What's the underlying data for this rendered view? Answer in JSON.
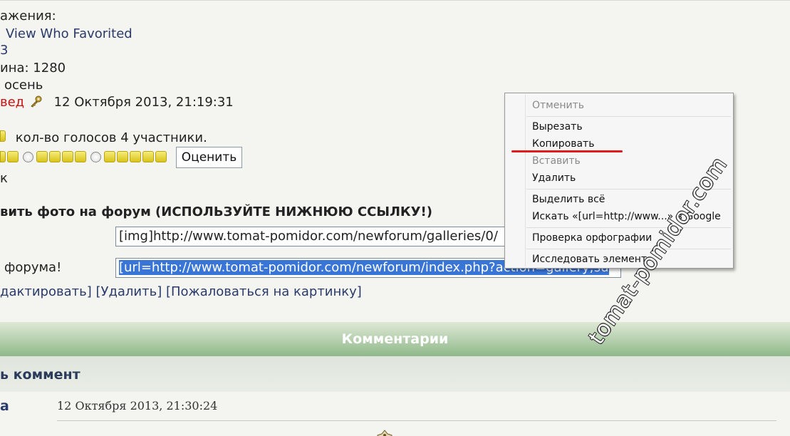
{
  "info": {
    "views_label": "ажения:",
    "who_favorited_link": "View Who Favorited",
    "fragment_b": "3",
    "width_label": "ина: 1280",
    "autumn_label": "осень",
    "author_fragment": "вед",
    "date": "12 Октября 2013, 21:19:31",
    "votes_text": "кол-во голосов 4 участники.",
    "fragment_k": "к"
  },
  "rating": {
    "button_label": "Оценить",
    "star_groups": [
      2,
      4,
      5
    ]
  },
  "embed": {
    "heading": "вить фото на форум (ИСПОЛЬЗУЙТЕ НИЖНЮЮ ССЫЛКУ!)",
    "img_code": "[img]http://www.tomat-pomidor.com/newforum/galleries/0/",
    "forum_label": "форума!",
    "url_code": "[url=http://www.tomat-pomidor.com/newforum/index.php?action=gallery;su"
  },
  "actions": {
    "text": "дактировать] [Удалить] [Пожаловаться на картинку]"
  },
  "comments": {
    "title": "Комментарии",
    "add_label": "ь коммент",
    "author": "а",
    "date": "12 Октября 2013, 21:30:24"
  },
  "context_menu": {
    "undo": "Отменить",
    "cut": "Вырезать",
    "copy": "Копировать",
    "paste": "Вставить",
    "delete": "Удалить",
    "select_all": "Выделить всё",
    "search": "Искать «[url=http://www...» в Google",
    "spellcheck": "Проверка орфографии",
    "inspect": "Исследовать элемент"
  },
  "watermark": "tomat-pomidor.com",
  "colors": {
    "link": "#2a3b6b",
    "highlight": "#e01b1b",
    "selection": "#3875d7",
    "comments_bar": "#8fb88a"
  }
}
